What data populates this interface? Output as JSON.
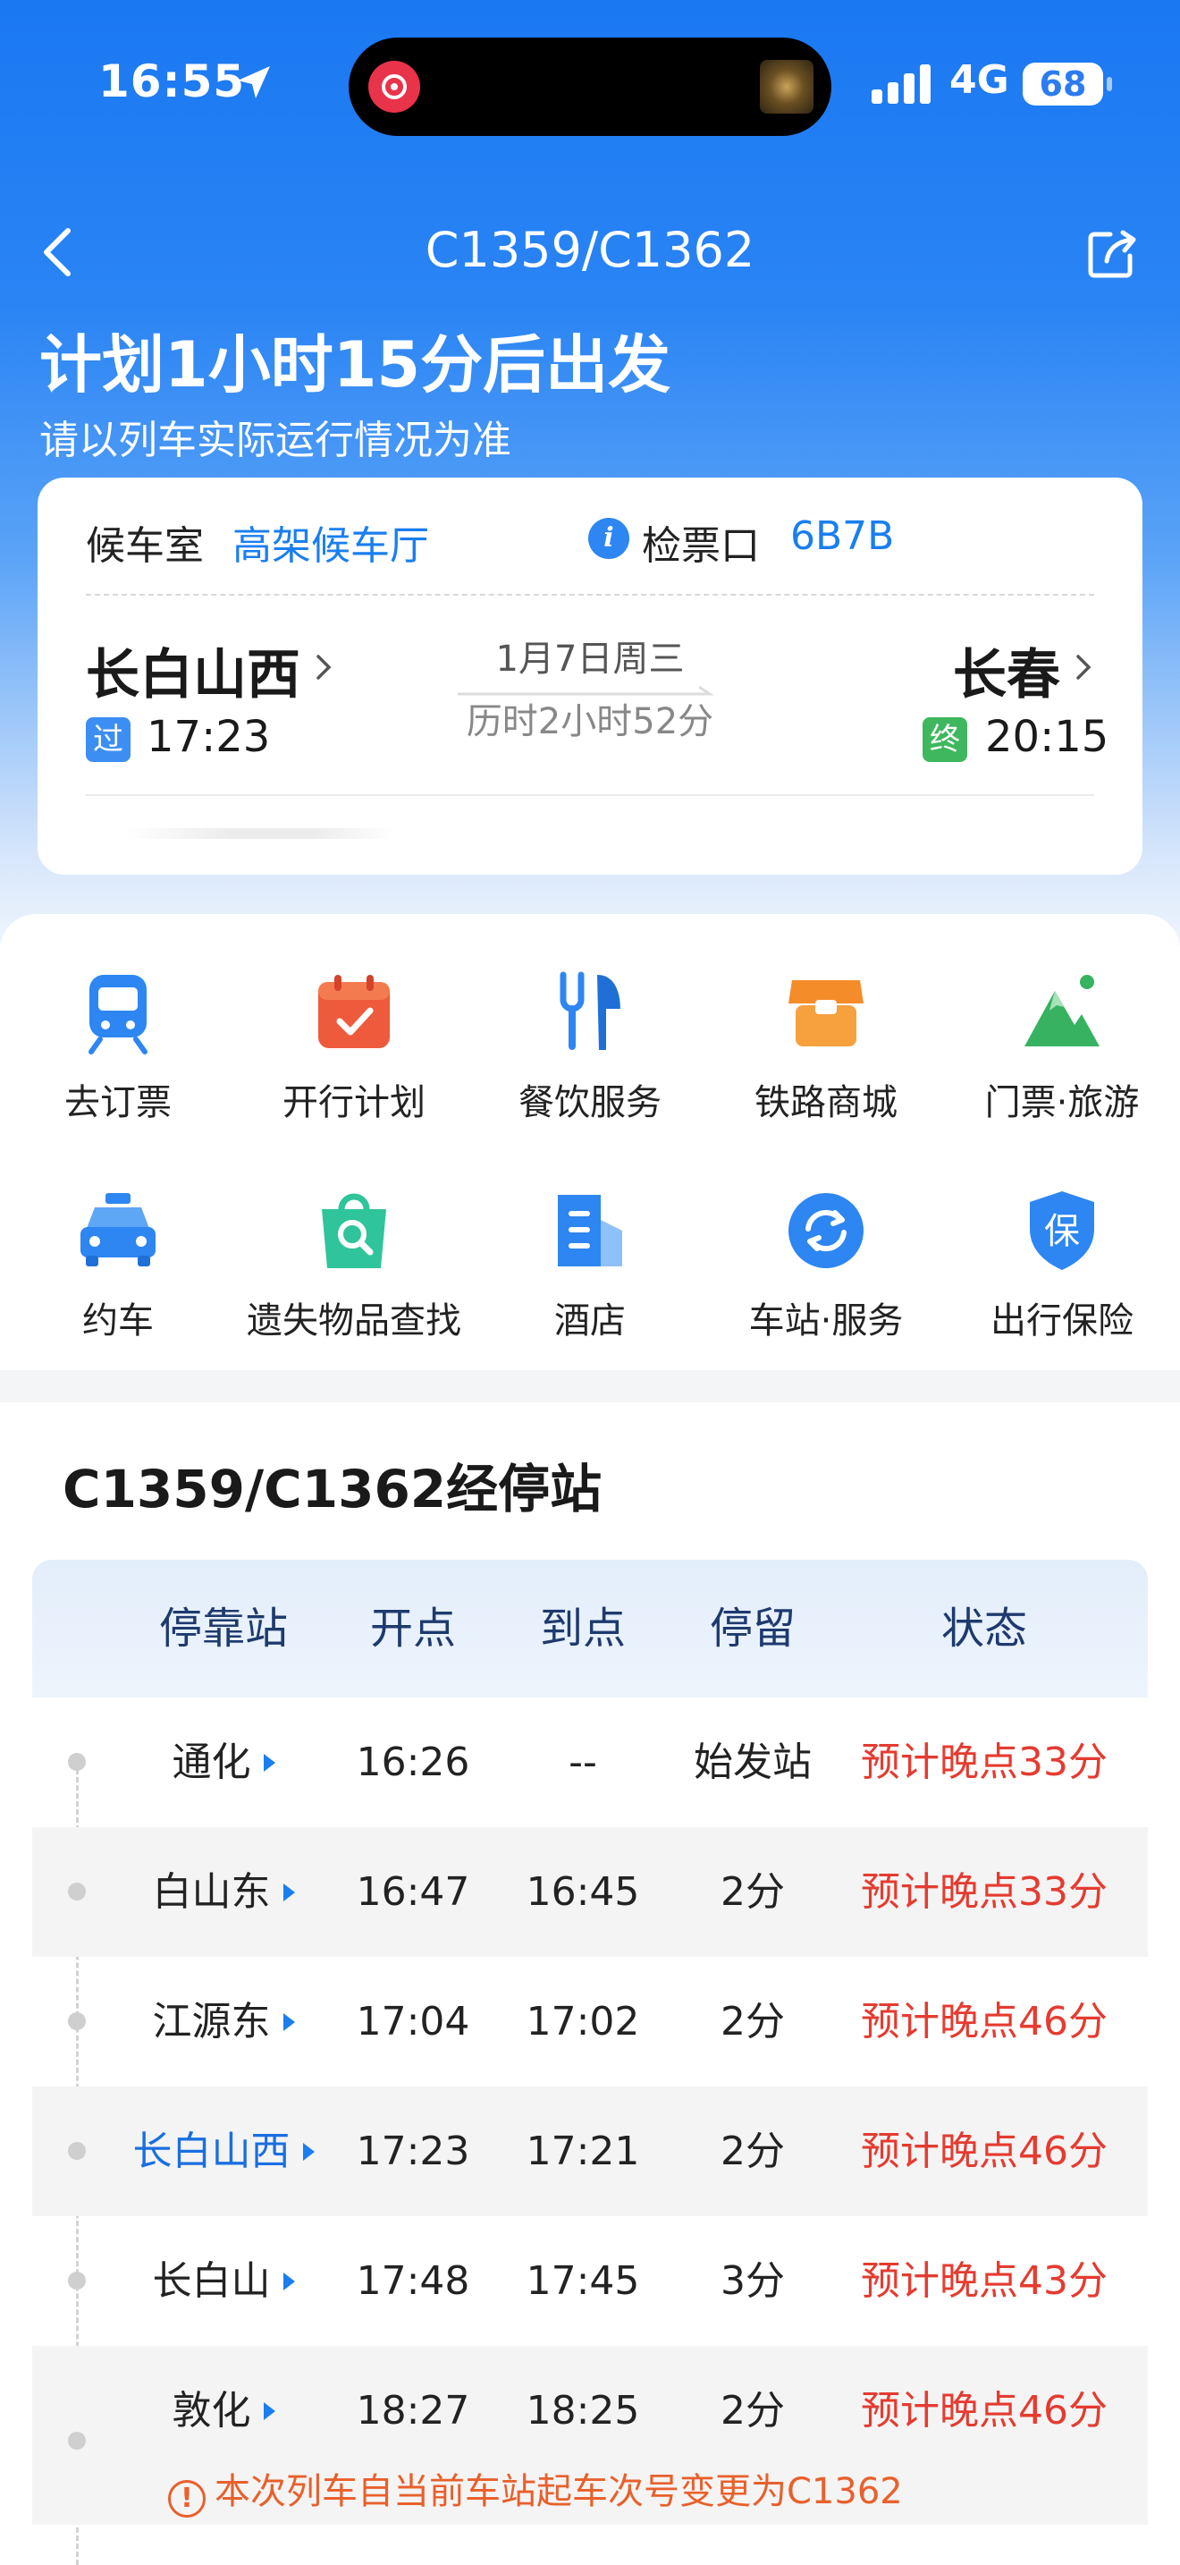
{
  "status_bar": {
    "time": "16:55",
    "network": "4G",
    "battery": "68"
  },
  "nav": {
    "title": "C1359/C1362"
  },
  "header": {
    "headline": "计划1小时15分后出发",
    "subline": "请以列车实际运行情况为准"
  },
  "ticket": {
    "waiting_room_label": "候车室",
    "waiting_room_value": "高架候车厅",
    "gate_label": "检票口",
    "gate_value": "6B7B",
    "from_station": "长白山西",
    "from_badge": "过",
    "departure_time": "17:23",
    "date": "1月7日周三",
    "duration": "历时2小时52分",
    "to_station": "长春",
    "to_badge": "终",
    "arrival_time": "20:15"
  },
  "services": [
    {
      "label": "去订票",
      "icon": "train-icon"
    },
    {
      "label": "开行计划",
      "icon": "calendar-icon"
    },
    {
      "label": "餐饮服务",
      "icon": "dining-icon"
    },
    {
      "label": "铁路商城",
      "icon": "shop-icon"
    },
    {
      "label": "门票·旅游",
      "icon": "mountain-icon"
    },
    {
      "label": "约车",
      "icon": "taxi-icon"
    },
    {
      "label": "遗失物品查找",
      "icon": "lost-found-icon"
    },
    {
      "label": "酒店",
      "icon": "hotel-icon"
    },
    {
      "label": "车站·服务",
      "icon": "station-service-icon"
    },
    {
      "label": "出行保险",
      "icon": "insurance-icon"
    }
  ],
  "stops": {
    "title": "C1359/C1362经停站",
    "headers": {
      "station": "停靠站",
      "depart": "开点",
      "arrive": "到点",
      "stay": "停留",
      "status": "状态"
    },
    "rows": [
      {
        "station": "通化",
        "depart": "16:26",
        "arrive": "--",
        "stay": "始发站",
        "status": "预计晚点33分"
      },
      {
        "station": "白山东",
        "depart": "16:47",
        "arrive": "16:45",
        "stay": "2分",
        "status": "预计晚点33分"
      },
      {
        "station": "江源东",
        "depart": "17:04",
        "arrive": "17:02",
        "stay": "2分",
        "status": "预计晚点46分"
      },
      {
        "station": "长白山西",
        "depart": "17:23",
        "arrive": "17:21",
        "stay": "2分",
        "status": "预计晚点46分"
      },
      {
        "station": "长白山",
        "depart": "17:48",
        "arrive": "17:45",
        "stay": "3分",
        "status": "预计晚点43分"
      },
      {
        "station": "敦化",
        "depart": "18:27",
        "arrive": "18:25",
        "stay": "2分",
        "status": "预计晚点46分"
      }
    ],
    "notice": "本次列车自当前车站起车次号变更为C1362",
    "notice_icon": "!"
  }
}
